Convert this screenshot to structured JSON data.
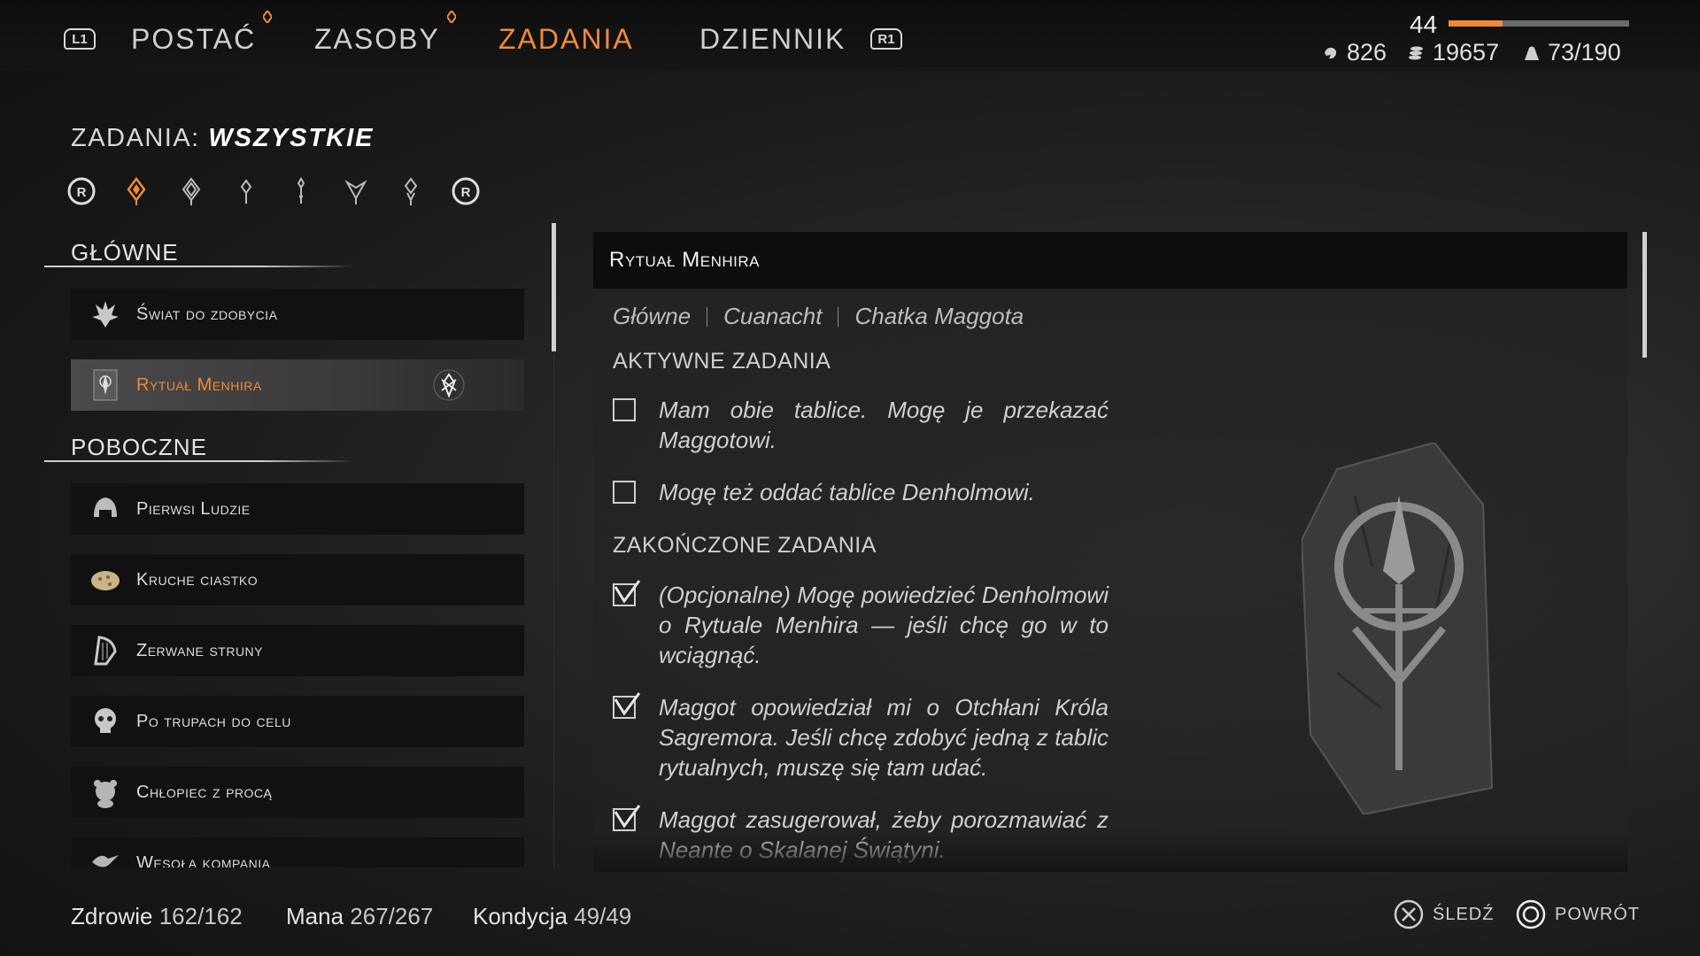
{
  "nav": {
    "left_bumper": "L1",
    "right_bumper": "R1",
    "tabs": [
      {
        "label": "POSTAĆ"
      },
      {
        "label": "ZASOBY"
      },
      {
        "label": "ZADANIA"
      },
      {
        "label": "DZIENNIK"
      }
    ],
    "active_tab": "ZADANIA"
  },
  "player": {
    "level": "44",
    "xp_fraction": 0.3,
    "stat1": "826",
    "stat2": "19657",
    "stat3": "73/190"
  },
  "quests_panel": {
    "title_prefix": "ZADANIA:",
    "title_filter": "WSZYSTKIE",
    "filter_bumper": "R",
    "main_header": "GŁÓWNE",
    "side_header": "POBOCZNE",
    "main": [
      {
        "label": "Świat do zdobycia",
        "icon": "crown-icon"
      },
      {
        "label": "Rytuał Menhira",
        "icon": "menhir-icon",
        "selected": true
      }
    ],
    "side": [
      {
        "label": "Pierwsi Ludzie",
        "icon": "helmet-icon"
      },
      {
        "label": "Kruche ciastko",
        "icon": "cookie-icon"
      },
      {
        "label": "Zerwane struny",
        "icon": "harp-icon"
      },
      {
        "label": "Po trupach do celu",
        "icon": "skull-icon"
      },
      {
        "label": "Chłopiec z procą",
        "icon": "bear-icon"
      },
      {
        "label": "Wesoła kompania",
        "icon": "bird-icon"
      }
    ]
  },
  "detail": {
    "title": "Rytuał Menhira",
    "crumbs": [
      "Główne",
      "Cuanacht",
      "Chatka Maggota"
    ],
    "active_header": "AKTYWNE ZADANIA",
    "active": [
      "Mam obie tablice. Mogę je przekazać Maggotowi.",
      "Mogę też oddać tablice Denholmowi."
    ],
    "done_header": "ZAKOŃCZONE ZADANIA",
    "done": [
      "(Opcjonalne) Mogę powiedzieć Denholmowi o Rytuale Menhira — jeśli chcę go w to wciągnąć.",
      "Maggot opowiedział mi o Otchłani Króla Sagremora. Jeśli chcę zdobyć jedną z tablic rytualnych, muszę się tam udać.",
      "Maggot zasugerował, żeby porozmawiać z Neante o Skalanej Świątyni."
    ]
  },
  "footer": {
    "health_label": "Zdrowie",
    "health_value": "162/162",
    "mana_label": "Mana",
    "mana_value": "267/267",
    "stamina_label": "Kondycja",
    "stamina_value": "49/49",
    "track_hint": "ŚLEDŹ",
    "back_hint": "POWRÓT"
  },
  "colors": {
    "accent": "#f08a3a",
    "panel": "#111111",
    "text": "#d8d8d8"
  }
}
